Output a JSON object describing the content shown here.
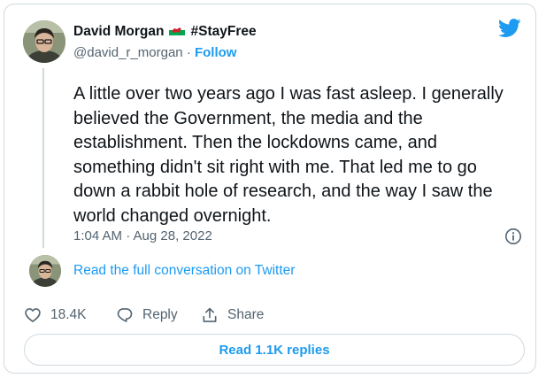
{
  "author": {
    "name": "David Morgan",
    "flag_icon": "wales-flag-icon",
    "tag": "#StayFree",
    "handle": "@david_r_morgan",
    "separator": "·",
    "follow_label": "Follow"
  },
  "tweet": {
    "text": "A little over two years ago I was fast asleep. I generally believed the Government, the media and the establishment. Then the lockdowns came, and something didn't sit right with me. That led me to go down a rabbit hole of research, and the way I saw the world changed overnight.",
    "timestamp": "1:04 AM · Aug 28, 2022"
  },
  "conversation_link": "Read the full conversation on Twitter",
  "actions": {
    "likes": "18.4K",
    "reply_label": "Reply",
    "share_label": "Share"
  },
  "read_replies_label": "Read 1.1K replies",
  "colors": {
    "brand_blue": "#1d9bf0",
    "text_primary": "#0f1419",
    "text_secondary": "#536471",
    "border": "#cfd9de"
  }
}
